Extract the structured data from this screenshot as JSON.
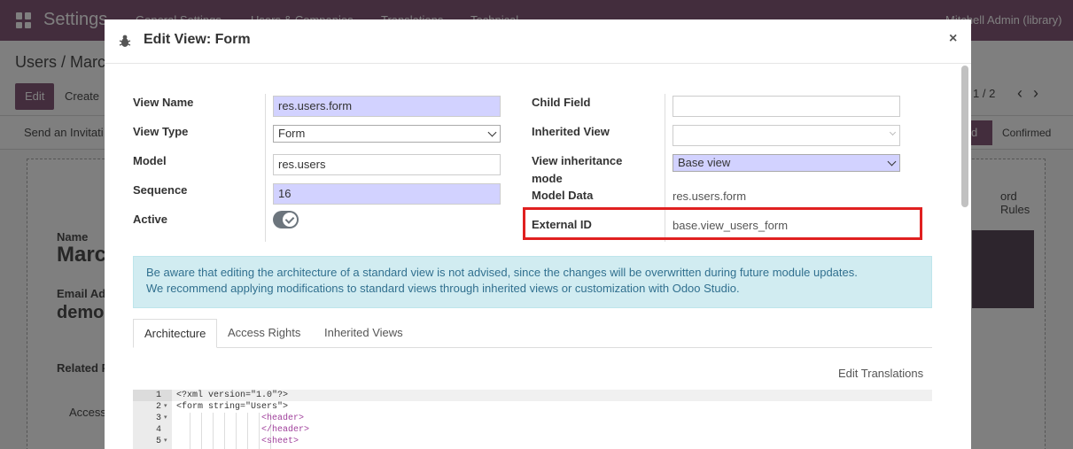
{
  "background": {
    "navbar": {
      "title": "Settings",
      "menu": [
        "General Settings",
        "Users & Companies",
        "Translations",
        "Technical"
      ],
      "user": "Mitchell Admin (library)"
    },
    "breadcrumb": "Users / Marc",
    "edit_label": "Edit",
    "create_label": "Create",
    "pager": "1 / 2",
    "send_invitation": "Send an Invitati",
    "stage_active": "d",
    "stage_confirmed": "Confirmed",
    "record_rules": "ord Rules",
    "name_label": "Name",
    "name_value": "Marc",
    "email_label": "Email Ad",
    "email_value": "demo",
    "related_label": "Related P",
    "access_label": "Access"
  },
  "modal": {
    "title": "Edit View: Form",
    "close_glyph": "×",
    "fields": {
      "view_name": {
        "label": "View Name",
        "value": "res.users.form"
      },
      "view_type": {
        "label": "View Type",
        "value": "Form"
      },
      "model": {
        "label": "Model",
        "value": "res.users"
      },
      "sequence": {
        "label": "Sequence",
        "value": "16"
      },
      "active": {
        "label": "Active",
        "checked": true
      },
      "child_field": {
        "label": "Child Field",
        "value": ""
      },
      "inherited_view": {
        "label": "Inherited View",
        "value": ""
      },
      "inheritance_mode": {
        "label_line1": "View inheritance",
        "label_line2": "mode",
        "value": "Base view"
      },
      "model_data": {
        "label": "Model Data",
        "value": "res.users.form"
      },
      "external_id": {
        "label": "External ID",
        "value": "base.view_users_form"
      }
    },
    "alert": {
      "line1": "Be aware that editing the architecture of a standard view is not advised, since the changes will be overwritten during future module updates.",
      "line2": "We recommend applying modifications to standard views through inherited views or customization with Odoo Studio."
    },
    "tabs": [
      "Architecture",
      "Access Rights",
      "Inherited Views"
    ],
    "active_tab": "Architecture",
    "edit_translations": "Edit Translations",
    "code_lines": [
      {
        "num": "1",
        "fold": "",
        "text": "<?xml version=\"1.0\"?>"
      },
      {
        "num": "2",
        "fold": "▾",
        "text": "<form string=\"Users\">"
      },
      {
        "num": "3",
        "fold": "▾",
        "text": "                <header>"
      },
      {
        "num": "4",
        "fold": "",
        "text": "                </header>"
      },
      {
        "num": "5",
        "fold": "▾",
        "text": "                <sheet>"
      }
    ]
  },
  "colors": {
    "brand": "#875a7b",
    "required_field": "#d2d2ff",
    "highlight": "#e02020",
    "alert_bg": "#d1ecf1"
  }
}
